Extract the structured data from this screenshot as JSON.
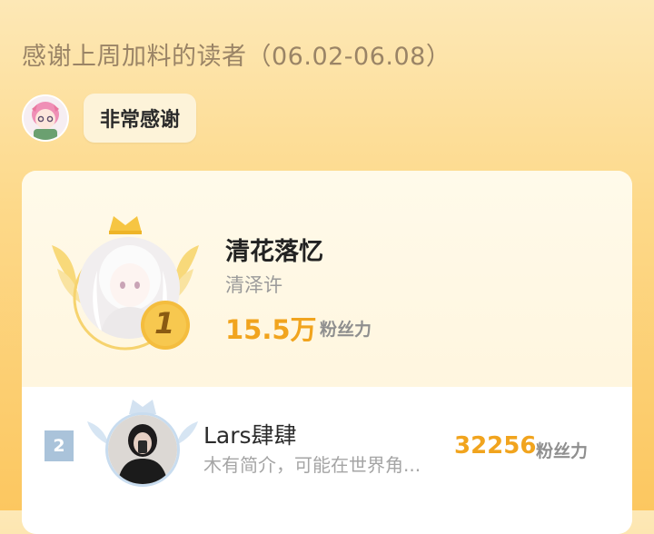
{
  "header": {
    "title": "感谢上周加料的读者（06.02-06.08）"
  },
  "thanks": {
    "bubble_text": "非常感谢"
  },
  "ranking": {
    "first": {
      "rank": "1",
      "name": "清花落忆",
      "subtitle": "清泽许",
      "count": "15.5万",
      "unit": "粉丝力"
    },
    "second": {
      "rank": "2",
      "name": "Lars肆肆",
      "subtitle": "木有简介，可能在世界角...",
      "count": "32256",
      "unit": "粉丝力"
    }
  },
  "colors": {
    "accent": "#f1a41e",
    "gold": "#f6c542",
    "silver": "#aac3da",
    "bg": "#fdd98a"
  },
  "icons": {
    "rank1": "crown-icon",
    "rank2": "silver-crown-icon"
  }
}
